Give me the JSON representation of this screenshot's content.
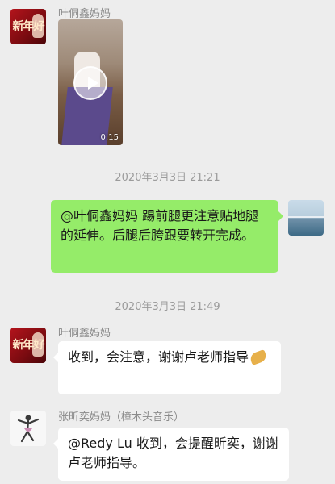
{
  "messages": [
    {
      "sender": "叶侗鑫妈妈",
      "type": "video",
      "duration": "0:15"
    },
    {
      "timestamp": "2020年3月3日 21:21"
    },
    {
      "sender": "self",
      "type": "text",
      "text": "@叶侗鑫妈妈 踢前腿更注意贴地腿的延伸。后腿后胯跟要转开完成。"
    },
    {
      "timestamp": "2020年3月3日 21:49"
    },
    {
      "sender": "叶侗鑫妈妈",
      "type": "text",
      "text": "收到，会注意，谢谢卢老师指导",
      "emoji": "pray-hands-emoji"
    },
    {
      "sender": "张昕奕妈妈（樟木头音乐）",
      "type": "text",
      "text": "@Redy Lu 收到，会提醒昕奕，谢谢卢老师指导。"
    }
  ],
  "avatar_icons": {
    "ye_mother": "red-new-year-avatar",
    "self": "seaside-photo-avatar",
    "zhang_mother": "dancer-avatar"
  },
  "colors": {
    "background": "#ededed",
    "self_bubble": "#95ec69",
    "other_bubble": "#ffffff"
  }
}
